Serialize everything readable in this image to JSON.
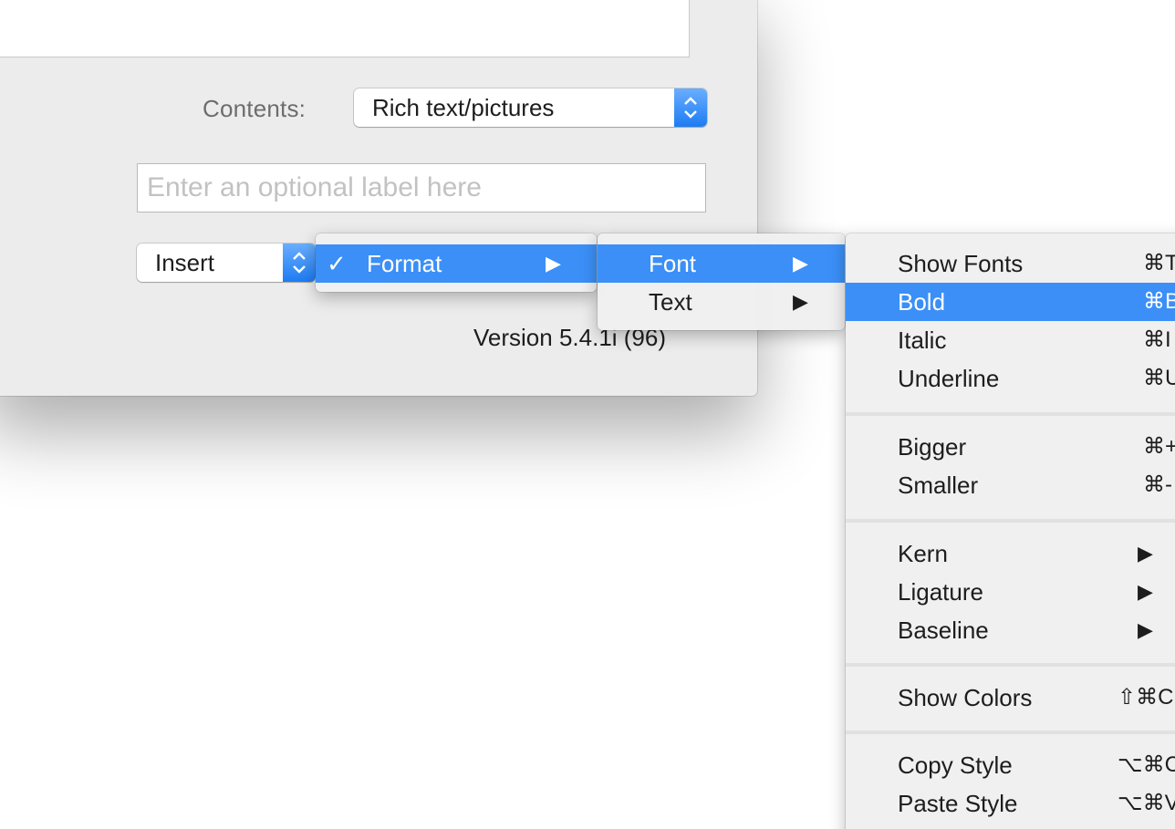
{
  "dialog": {
    "contents_label": "Contents:",
    "contents_value": "Rich text/pictures",
    "label_placeholder": "Enter an optional label here",
    "insert_value": "Insert",
    "version": "Version 5.4.1i (96)",
    "stepper_icon": "⌃⌄"
  },
  "menus": {
    "level1": {
      "check": "✓",
      "items": [
        {
          "label": "Format",
          "submenu": true,
          "selected": true
        }
      ]
    },
    "level2": {
      "items": [
        {
          "label": "Font",
          "submenu": true,
          "selected": true
        },
        {
          "label": "Text",
          "submenu": true,
          "selected": false
        }
      ]
    },
    "level3": {
      "items": [
        {
          "label": "Show Fonts",
          "shortcut": "⌘T"
        },
        {
          "label": "Bold",
          "shortcut": "⌘B",
          "selected": true
        },
        {
          "label": "Italic",
          "shortcut": "⌘I"
        },
        {
          "label": "Underline",
          "shortcut": "⌘U"
        },
        {
          "label": "Bigger",
          "shortcut": "⌘+"
        },
        {
          "label": "Smaller",
          "shortcut": "⌘-"
        },
        {
          "label": "Kern",
          "submenu": true
        },
        {
          "label": "Ligature",
          "submenu": true
        },
        {
          "label": "Baseline",
          "submenu": true
        },
        {
          "label": "Show Colors",
          "shortcut": "⇧⌘C"
        },
        {
          "label": "Copy Style",
          "shortcut": "⌥⌘C"
        },
        {
          "label": "Paste Style",
          "shortcut": "⌥⌘V"
        }
      ]
    },
    "arrow_glyph": "▶"
  },
  "colors": {
    "selection": "#3b8ff7",
    "accent": "#1d7cf2"
  }
}
